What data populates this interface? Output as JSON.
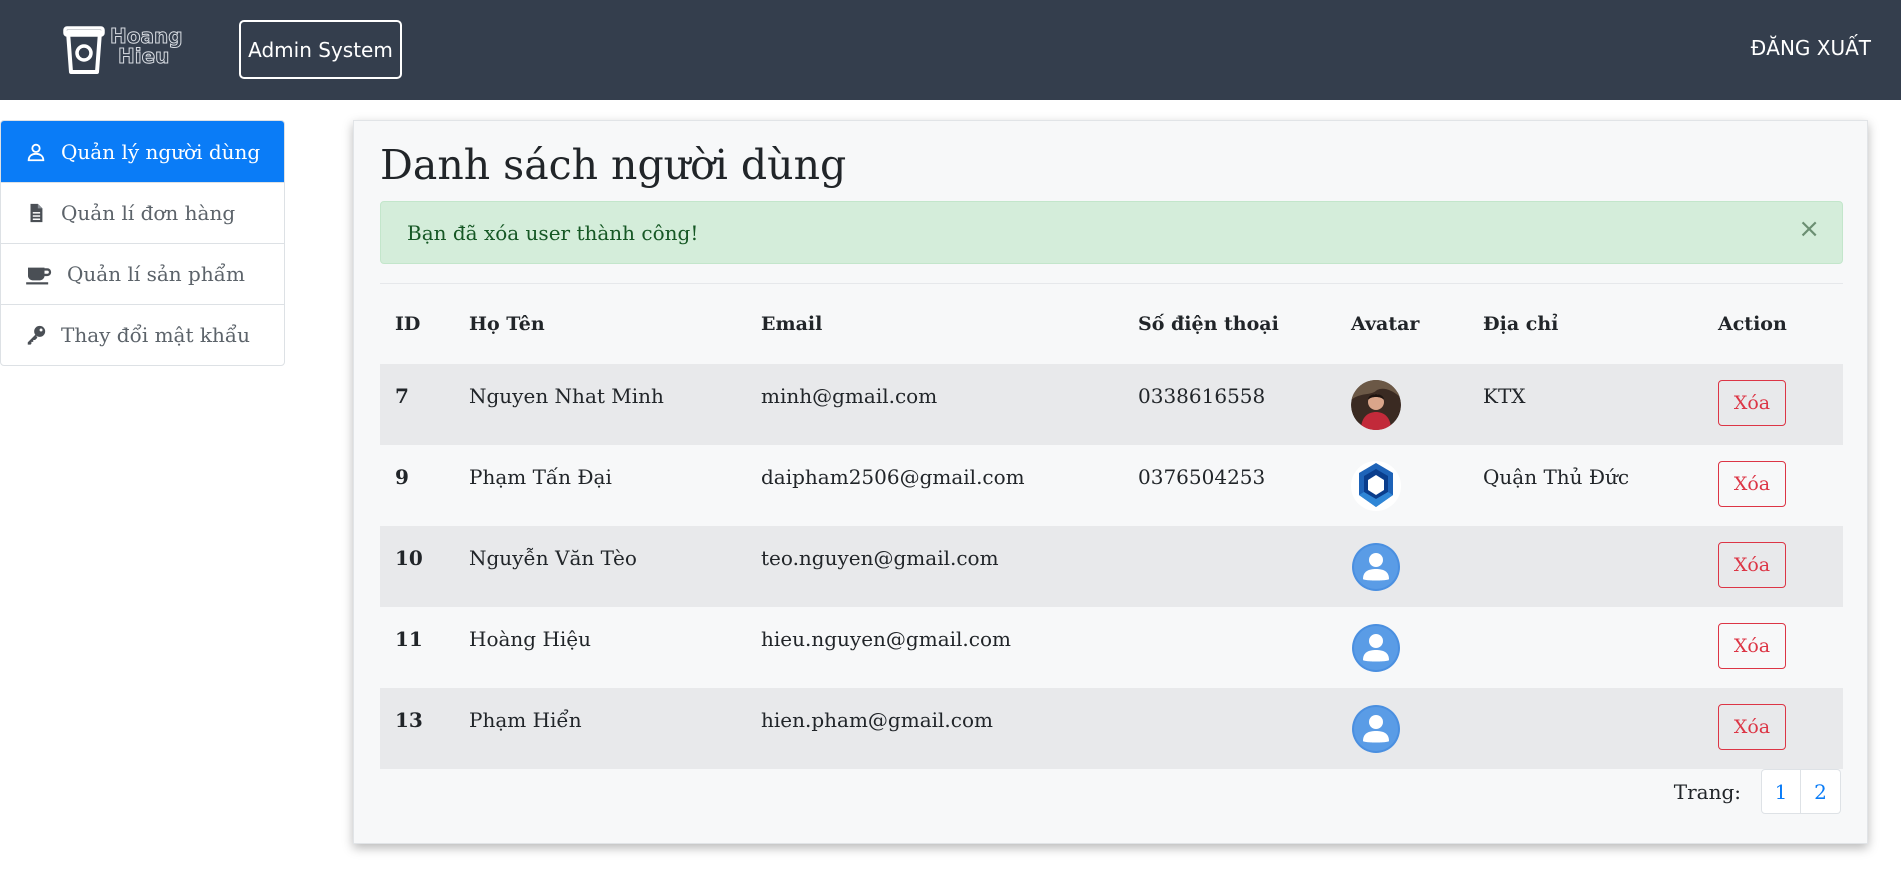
{
  "header": {
    "logo_text_line1": "Hoang",
    "logo_text_line2": "Hieu",
    "brand_label": "Admin System",
    "logout_label": "ĐĂNG XUẤT"
  },
  "sidebar": {
    "items": [
      {
        "label": "Quản lý người dùng",
        "icon": "user-icon",
        "active": true
      },
      {
        "label": "Quản lí đơn hàng",
        "icon": "document-icon",
        "active": false
      },
      {
        "label": "Quản lí sản phẩm",
        "icon": "coffee-cup-icon",
        "active": false
      },
      {
        "label": "Thay đổi mật khẩu",
        "icon": "key-icon",
        "active": false
      }
    ]
  },
  "main": {
    "title": "Danh sách người dùng",
    "alert": {
      "message": "Bạn đã xóa user thành công!",
      "close": "×"
    },
    "table": {
      "headers": [
        "ID",
        "Họ Tên",
        "Email",
        "Số điện thoại",
        "Avatar",
        "Địa chỉ",
        "Action"
      ],
      "rows": [
        {
          "id": "7",
          "name": "Nguyen Nhat Minh",
          "email": "minh@gmail.com",
          "phone": "0338616558",
          "avatar": "photo-avatar",
          "address": "KTX",
          "action": "Xóa"
        },
        {
          "id": "9",
          "name": "Phạm Tấn Đại",
          "email": "daipham2506@gmail.com",
          "phone": "0376504253",
          "avatar": "bk-logo-avatar",
          "address": "Quận Thủ Đức",
          "action": "Xóa"
        },
        {
          "id": "10",
          "name": "Nguyễn Văn Tèo",
          "email": "teo.nguyen@gmail.com",
          "phone": "",
          "avatar": "default-user-avatar",
          "address": "",
          "action": "Xóa"
        },
        {
          "id": "11",
          "name": "Hoàng Hiệu",
          "email": "hieu.nguyen@gmail.com",
          "phone": "",
          "avatar": "default-user-avatar",
          "address": "",
          "action": "Xóa"
        },
        {
          "id": "13",
          "name": "Phạm Hiển",
          "email": "hien.pham@gmail.com",
          "phone": "",
          "avatar": "default-user-avatar",
          "address": "",
          "action": "Xóa"
        }
      ]
    },
    "pagination": {
      "label": "Trang:",
      "pages": [
        "1",
        "2"
      ]
    }
  },
  "colors": {
    "navbar": "#343e4d",
    "active": "#0a7cf7",
    "danger": "#dc3545",
    "alert_bg": "#d4edda",
    "alert_text": "#155724"
  }
}
